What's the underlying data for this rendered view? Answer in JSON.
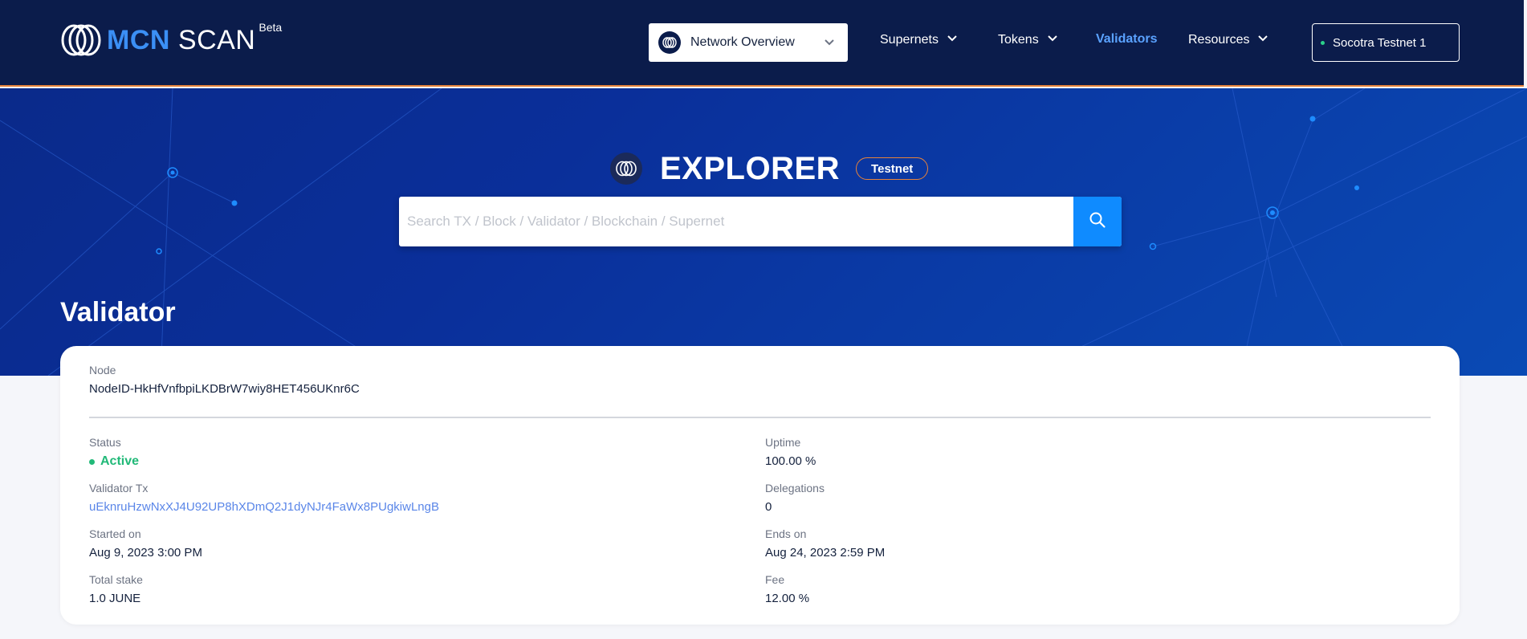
{
  "header": {
    "logo_mcn": "MCN",
    "logo_scan": "SCAN",
    "logo_beta": "Beta",
    "network_select": "Network Overview",
    "nav": {
      "supernets": "Supernets",
      "tokens": "Tokens",
      "validators": "Validators",
      "resources": "Resources"
    },
    "network_button": "Socotra Testnet 1"
  },
  "hero": {
    "title": "EXPLORER",
    "badge": "Testnet",
    "search_placeholder": "Search TX / Block / Validator / Blockchain / Supernet"
  },
  "page": {
    "title": "Validator"
  },
  "validator": {
    "node_label": "Node",
    "node_value": "NodeID-HkHfVnfbpiLKDBrW7wiy8HET456UKnr6C",
    "status_label": "Status",
    "status_value": "Active",
    "tx_label": "Validator Tx",
    "tx_value": "uEknruHzwNxXJ4U92UP8hXDmQ2J1dyNJr4FaWx8PUgkiwLngB",
    "started_label": "Started on",
    "started_value": "Aug 9, 2023 3:00 PM",
    "stake_label": "Total stake",
    "stake_value": "1.0 JUNE",
    "uptime_label": "Uptime",
    "uptime_value": "100.00 %",
    "delegations_label": "Delegations",
    "delegations_value": "0",
    "ends_label": "Ends on",
    "ends_value": "Aug 24, 2023 2:59 PM",
    "fee_label": "Fee",
    "fee_value": "12.00 %"
  },
  "colors": {
    "header_bg": "#0b1c4b",
    "accent_orange": "#e8833a",
    "accent_blue": "#0f8bff",
    "active_green": "#21b978",
    "link_blue": "#5a86e8"
  },
  "icons": [
    "mcn-logo-icon",
    "network-icon",
    "chevron-down-icon",
    "search-icon",
    "explorer-icon",
    "status-dot-icon"
  ]
}
